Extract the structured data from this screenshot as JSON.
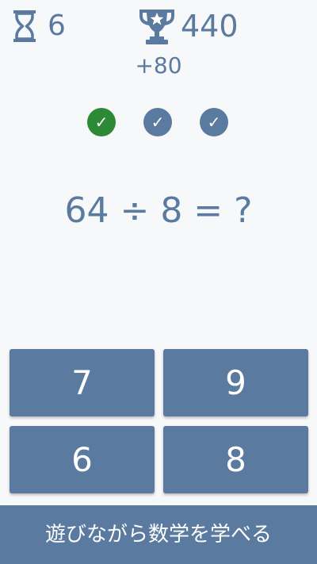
{
  "timer": {
    "icon": "hourglass-icon",
    "value": "6"
  },
  "score": {
    "icon": "trophy-icon",
    "value": "440",
    "bonus": "+80"
  },
  "progress": {
    "items": [
      {
        "status": "correct",
        "symbol": "✓",
        "color": "#2c8a36"
      },
      {
        "status": "pending",
        "symbol": "✓",
        "color": "#5a7aa0"
      },
      {
        "status": "pending",
        "symbol": "✓",
        "color": "#5a7aa0"
      }
    ]
  },
  "question": "64 ÷ 8 = ?",
  "answers": [
    "7",
    "9",
    "6",
    "8"
  ],
  "banner": "遊びながら数学を学べる",
  "colors": {
    "accent": "#5a7aa0",
    "correct": "#2c8a36",
    "background": "#f7f8fa",
    "button_text": "#ffffff"
  }
}
